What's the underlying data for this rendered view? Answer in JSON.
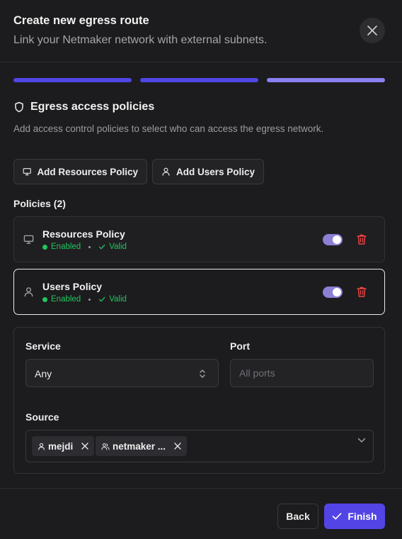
{
  "dialog": {
    "title": "Create new egress route",
    "subtitle": "Link your Netmaker network with external subnets."
  },
  "steps": {
    "total": 3,
    "current": 3,
    "colors": [
      "#4f46e5",
      "#4f46e5",
      "#8b80f0"
    ]
  },
  "section": {
    "title": "Egress access policies",
    "description": "Add access control policies to select who can access the egress network.",
    "icon": "shield-icon"
  },
  "actions": {
    "add_resources": "Add Resources Policy",
    "add_users": "Add Users Policy"
  },
  "policies": {
    "label": "Policies (2)",
    "items": [
      {
        "name": "Resources Policy",
        "status": "Enabled",
        "validity": "Valid",
        "enabled": true,
        "icon": "monitor-icon"
      },
      {
        "name": "Users Policy",
        "status": "Enabled",
        "validity": "Valid",
        "enabled": true,
        "icon": "user-icon"
      }
    ]
  },
  "detail": {
    "service_label": "Service",
    "service_value": "Any",
    "port_label": "Port",
    "port_placeholder": "All ports",
    "source_label": "Source",
    "source_chips": [
      {
        "label": "mejdi",
        "icon": "user-icon"
      },
      {
        "label": "netmaker ...",
        "icon": "users-icon"
      }
    ]
  },
  "footer": {
    "back": "Back",
    "finish": "Finish"
  },
  "colors": {
    "accent": "#5344e6",
    "success": "#22c55e",
    "danger": "#ef4444",
    "toggle_on": "#8b7fd6"
  }
}
